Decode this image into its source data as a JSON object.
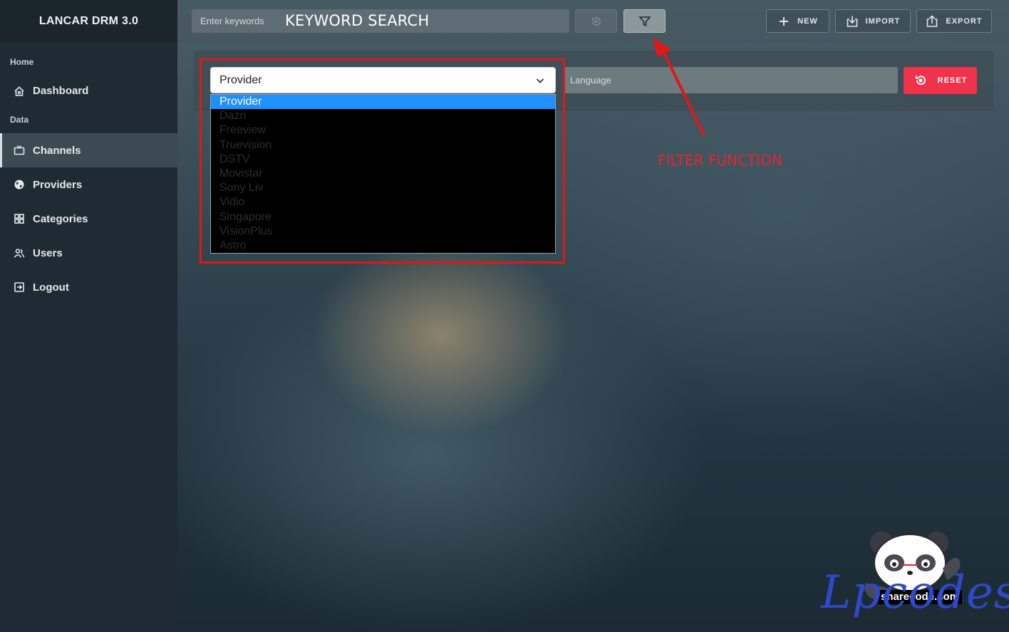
{
  "app": {
    "title": "LANCAR DRM 3.0"
  },
  "sidebar": {
    "sections": [
      {
        "label": "Home"
      },
      {
        "label": "Data"
      }
    ],
    "items": [
      {
        "label": "Dashboard",
        "icon": "home-icon"
      },
      {
        "label": "Channels",
        "icon": "tv-icon",
        "active": true
      },
      {
        "label": "Providers",
        "icon": "globe-icon"
      },
      {
        "label": "Categories",
        "icon": "grid-icon"
      },
      {
        "label": "Users",
        "icon": "users-icon"
      },
      {
        "label": "Logout",
        "icon": "logout-icon"
      }
    ]
  },
  "toolbar": {
    "search_placeholder": "Enter keywords",
    "new_label": "NEW",
    "import_label": "IMPORT",
    "export_label": "EXPORT"
  },
  "filters": {
    "provider_selected": "Provider",
    "language_placeholder": "Language",
    "reset_label": "RESET",
    "provider_options": [
      "Provider",
      "Dazn",
      "Freeview",
      "Truevision",
      "DSTV",
      "Movistar",
      "Sony Liv",
      "Vidio",
      "Singapore",
      "VisionPlus",
      "Astro"
    ]
  },
  "annotations": {
    "keyword": "KEYWORD SEARCH",
    "filter": "FILTER FUNCTION",
    "color": "#e01717"
  },
  "watermark": {
    "site": "sharecode.com",
    "brand": "Lpcodes"
  },
  "colors": {
    "sidebar": "#1f2b32",
    "accent_reset": "#f0334a",
    "selected_option": "#1e90ff"
  }
}
